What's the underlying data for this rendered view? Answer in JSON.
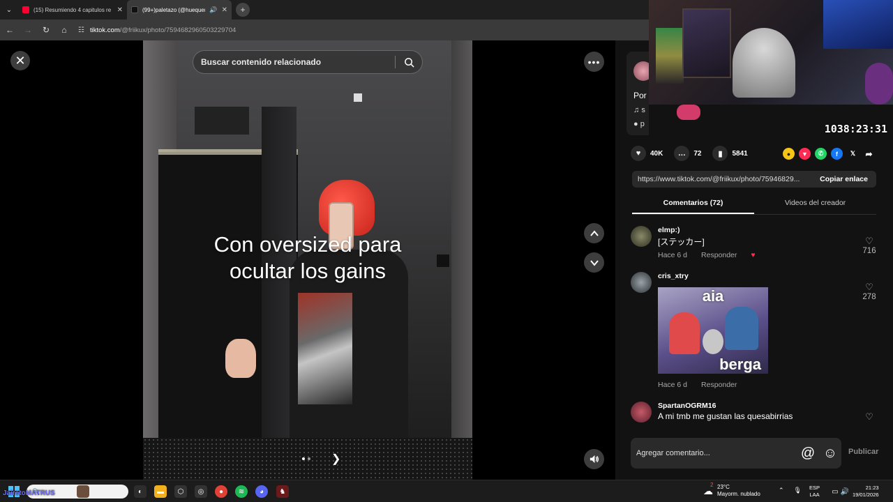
{
  "browser": {
    "tabs": [
      {
        "label": "(15) Resumiendo 4 capitulos re",
        "active": false
      },
      {
        "label": "(99+)paletazo (@huequero",
        "active": true
      }
    ],
    "url_host": "tiktok.com",
    "url_path": "/@friikux/photo/7594682960503229704"
  },
  "viewer": {
    "search_placeholder": "Buscar contenido relacionado",
    "caption_line1": "Con oversized para",
    "caption_line2": "ocultar los gains"
  },
  "panel": {
    "creator_desc": "Por",
    "music": "s",
    "tag": "p",
    "likes": "40K",
    "comments": "72",
    "saves": "5841",
    "link_url": "https://www.tiktok.com/@friikux/photo/75946829...",
    "copy_label": "Copiar enlace",
    "tab_comments": "Comentarios (72)",
    "tab_videos": "Videos del creador",
    "comment_list": [
      {
        "user": "elmp:)",
        "text": "[ステッカー]",
        "time": "Hace 6 d",
        "reply": "Responder",
        "likes": "716"
      },
      {
        "user": "cris_xtry",
        "sticker_top": "aia",
        "sticker_bottom": "berga",
        "time": "Hace 6 d",
        "reply": "Responder",
        "likes": "278"
      },
      {
        "user": "SpartanOGRM16",
        "text": "A mi tmb me gustan las quesabirrias"
      }
    ],
    "compose_placeholder": "Agregar comentario...",
    "publish_label": "Publicar"
  },
  "webcam": {
    "timer": "1038:23:31"
  },
  "taskbar": {
    "overlay_name": "JairetoMATRUS",
    "weather_temp": "23°C",
    "weather_desc": "Mayorm. nublado",
    "weather_badge": "2",
    "lang_1": "ESP",
    "lang_2": "LAA",
    "time": "21:23",
    "date": "19/01/2026"
  },
  "icons": {
    "back": "arrow-left-icon",
    "forward": "arrow-right-icon",
    "reload": "reload-icon",
    "home": "home-icon",
    "close": "close-icon",
    "more": "more-icon",
    "search": "search-icon",
    "heart": "heart-icon",
    "comment": "comment-icon",
    "bookmark": "bookmark-icon",
    "volume": "volume-icon"
  },
  "colors": {
    "accent": "#fe2c55",
    "panel_bg": "#121212",
    "page_bg": "#000000"
  }
}
